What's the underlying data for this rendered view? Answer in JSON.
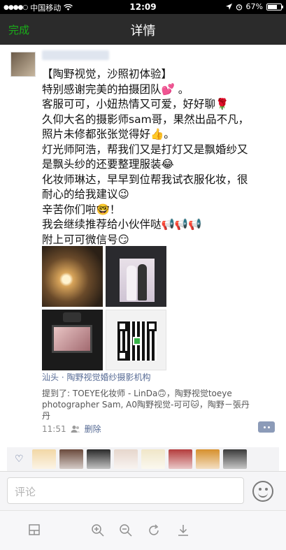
{
  "status_bar": {
    "signal": "●●●●○",
    "carrier": "中国移动",
    "wifi": "wifi-icon",
    "time": "12:09",
    "battery": "67%"
  },
  "nav": {
    "left_button": "完成",
    "title": "详情"
  },
  "post": {
    "lines": [
      "【陶野视觉，沙照初体验】",
      "特别感谢完美的拍摄团队💕 。",
      "客服可可，小妞热情又可爱，好好聊🌹",
      "久仰大名的摄影师sam哥，果然出品不凡，",
      "照片未修都张张觉得好👍。",
      "灯光师阿浩，帮我们又是打灯又是飘婚纱又",
      "是飘头纱的还要整理服装😂",
      "化妆师琳达，早早到位帮我试衣服化妆，很",
      "耐心的给我建议😉",
      "辛苦你们啦🤓！",
      "我会继续推荐给小伙伴哒📢📢📢",
      "附上可可微信号😏"
    ],
    "location": "汕头 · 陶野视觉婚纱摄影机构",
    "mention": "提到了: TOEYE化妆师 - LinDa🙃，陶野视觉toeye photographer Sam, A0陶野视觉-可可🐱，陶野－張丹丹",
    "time": "11:51",
    "delete_label": "删除",
    "photo_count": 4
  },
  "likes": {
    "count": 8,
    "face_colors": [
      "#f2d7a6",
      "#6b4a3c",
      "#2a2a2a",
      "#e6d6cc",
      "#f0e6c8",
      "#b43c3c",
      "#d6902c",
      "#3a3a3a"
    ]
  },
  "composer": {
    "placeholder": "评论"
  },
  "toolbar": {
    "icons": [
      "layout-icon",
      "zoom-in-icon",
      "zoom-out-icon",
      "rotate-icon",
      "download-icon"
    ]
  },
  "colors": {
    "accent_green": "#1aad19",
    "link_blue": "#576b95",
    "nav_bg": "#2b2b2b"
  }
}
